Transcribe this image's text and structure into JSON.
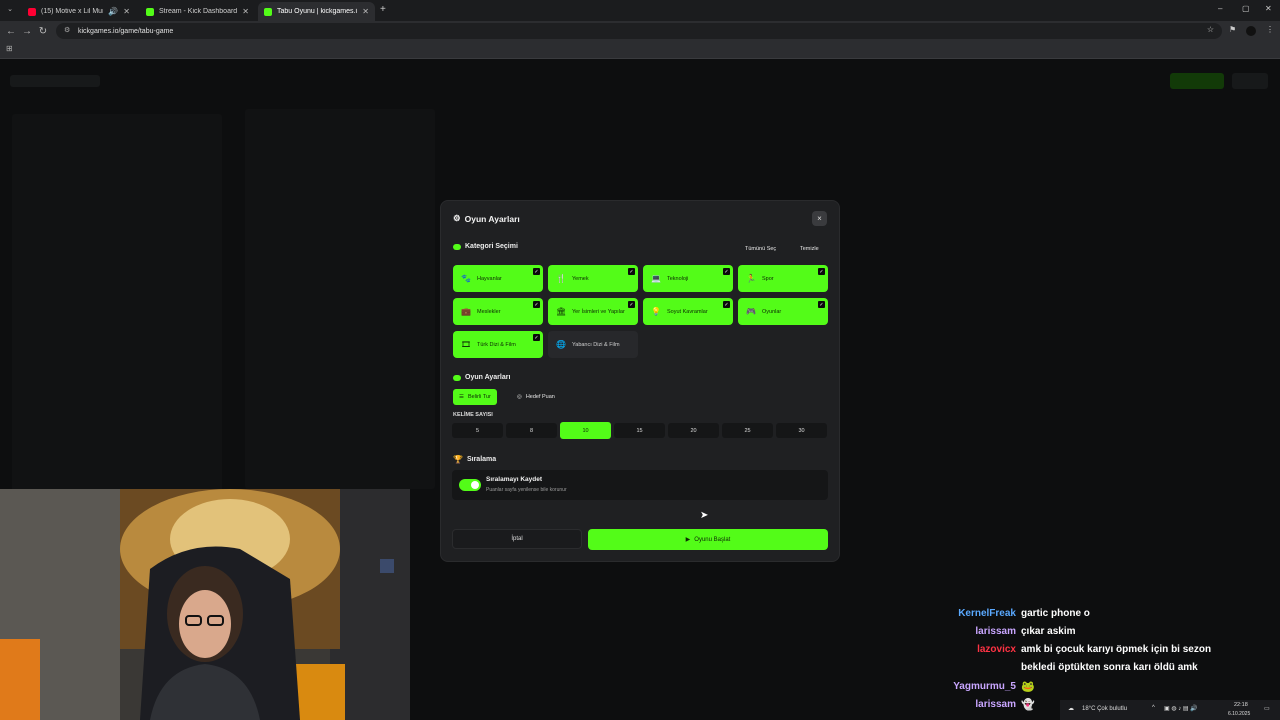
{
  "browser": {
    "tabs": [
      {
        "title": "(15) Motive x Lil Murda - G",
        "favicon_color": "#ff0033",
        "active": false
      },
      {
        "title": "Stream - Kick Dashboard",
        "favicon_color": "#53fc18",
        "active": false
      },
      {
        "title": "Tabu Oyunu | kickgames.io",
        "favicon_color": "#53fc18",
        "active": true
      }
    ],
    "new_tab": "+",
    "url": "kickgames.io/game/tabu-game"
  },
  "modal": {
    "title": "Oyun Ayarları",
    "close": "×",
    "category_section": {
      "title": "Kategori Seçimi",
      "select_all": "Tümünü Seç",
      "clear": "Temizle",
      "categories": [
        {
          "label": "Hayvanlar",
          "icon": "paw-icon",
          "glyph": "🐾",
          "selected": true
        },
        {
          "label": "Yemek",
          "icon": "utensils-icon",
          "glyph": "🍴",
          "selected": true
        },
        {
          "label": "Teknoloji",
          "icon": "laptop-icon",
          "glyph": "💻",
          "selected": true
        },
        {
          "label": "Spor",
          "icon": "running-icon",
          "glyph": "🏃",
          "selected": true
        },
        {
          "label": "Meslekler",
          "icon": "briefcase-icon",
          "glyph": "💼",
          "selected": true
        },
        {
          "label": "Yer İsimleri ve Yapılar",
          "icon": "building-icon",
          "glyph": "🏛",
          "selected": true
        },
        {
          "label": "Soyut Kavramlar",
          "icon": "lightbulb-icon",
          "glyph": "💡",
          "selected": true
        },
        {
          "label": "Oyunlar",
          "icon": "gamepad-icon",
          "glyph": "🎮",
          "selected": true
        },
        {
          "label": "Türk Dizi & Film",
          "icon": "film-icon",
          "glyph": "🎞",
          "selected": true
        },
        {
          "label": "Yabancı Dizi & Film",
          "icon": "globe-icon",
          "glyph": "🌐",
          "selected": false
        }
      ]
    },
    "game_section": {
      "title": "Oyun Ayarları",
      "modes": [
        {
          "label": "Belirli Tur",
          "icon": "list-icon",
          "selected": true
        },
        {
          "label": "Hedef Puan",
          "icon": "target-icon",
          "selected": false
        }
      ],
      "word_count_label": "KELİME SAYISI",
      "word_counts": [
        "5",
        "8",
        "10",
        "15",
        "20",
        "25",
        "30"
      ],
      "selected_word_count": "10"
    },
    "ranking_section": {
      "title": "Sıralama",
      "toggle_title": "Sıralamayı Kaydet",
      "toggle_desc": "Puanlar sayfa yenilense bile korunur",
      "enabled": true
    },
    "cancel_label": "İptal",
    "start_label": "Oyunu Başlat"
  },
  "chat": [
    {
      "user": "KernelFreak",
      "color": "#5aa9ff",
      "text": "gartic phone o"
    },
    {
      "user": "larissam",
      "color": "#c9a6ff",
      "text": "çıkar askim"
    },
    {
      "user": "lazovicx",
      "color": "#ff3344",
      "text": "amk bi çocuk karıyı öpmek için bi sezon"
    },
    {
      "user": "",
      "color": "#ffffff",
      "text": "bekledi öptükten sonra karı öldü amk"
    },
    {
      "user": "Yagmurmu_5",
      "color": "#c9a6ff",
      "text": ""
    },
    {
      "user": "larissam",
      "color": "#c9a6ff",
      "text": ""
    }
  ],
  "taskbar": {
    "weather": "18°C  Çok bulutlu",
    "time": "22:18",
    "date": "6.10.2025"
  },
  "colors": {
    "accent": "#53fc18",
    "modal_bg": "#1f2022"
  }
}
